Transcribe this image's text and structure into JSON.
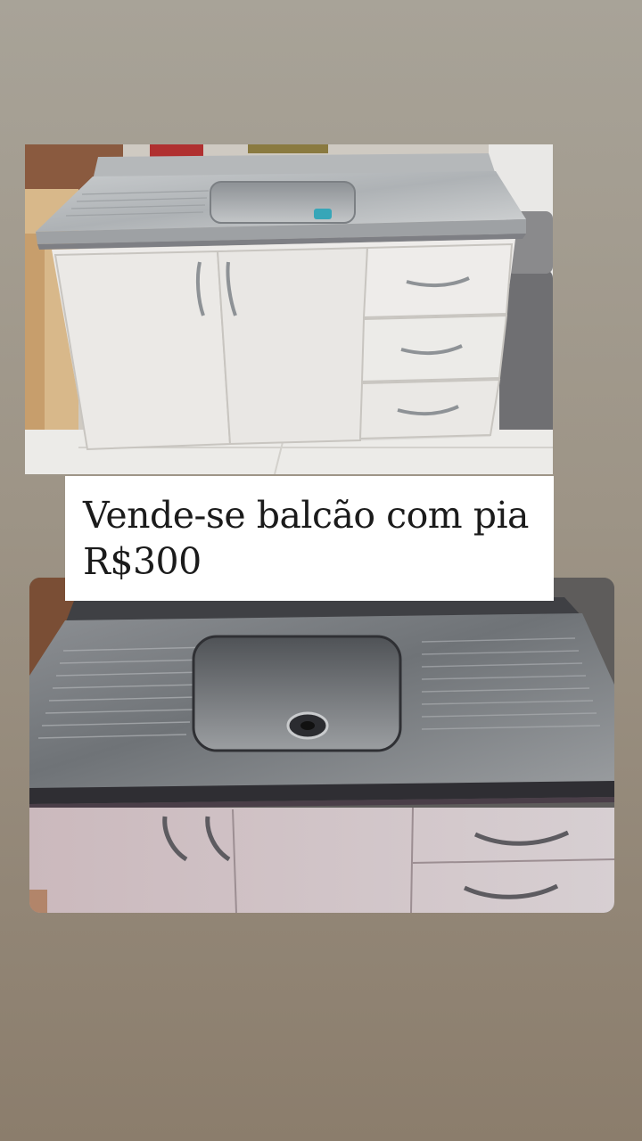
{
  "caption": {
    "line1": "Vende-se balcão com pia",
    "line2": "R$300"
  },
  "photos": [
    {
      "subject": "sink-cabinet-front-view"
    },
    {
      "subject": "sink-countertop-close-up"
    }
  ],
  "colors": {
    "background_top": "#a8a398",
    "background_bottom": "#8b7d6c",
    "caption_background": "#ffffff",
    "caption_text": "#1b1b1b",
    "cabinet": "#e6e4e2",
    "steel": "#b9bbbd"
  }
}
